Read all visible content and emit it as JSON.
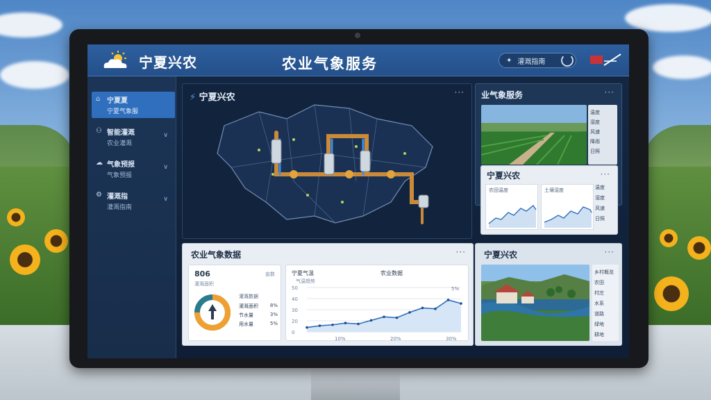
{
  "header": {
    "brand": "宁夏兴农",
    "title": "农业气象服务",
    "action_button": "灌溉指南"
  },
  "sidebar": {
    "items": [
      {
        "label": "宁夏夏",
        "sub": "宁夏气象服",
        "active": true
      },
      {
        "label": "智能灌溉",
        "sub": "农业灌溉",
        "active": false
      },
      {
        "label": "气象预报",
        "sub": "气象预报",
        "active": false
      },
      {
        "label": "灌溉指",
        "sub": "灌溉指南",
        "active": false
      }
    ]
  },
  "map_panel": {
    "title": "宁夏兴农",
    "more": "···"
  },
  "weather_panel": {
    "title": "业气象服务",
    "more": "···",
    "list": [
      "温度",
      "湿度",
      "风速",
      "降雨",
      "日照"
    ]
  },
  "sub_panel": {
    "title": "宁夏兴农",
    "more": "···",
    "mini1_header": "农田温度",
    "mini2_header": "土壤湿度",
    "list": [
      "温度",
      "湿度",
      "风速",
      "日照"
    ]
  },
  "bottom_panel": {
    "title": "农业气象数据",
    "more": "···",
    "stat_head": "806",
    "stat_sub": "灌溉面积",
    "stat_tag": "亩数",
    "legend_head": "灌溉数据",
    "legend": [
      {
        "label": "灌溉面积",
        "value": "8%"
      },
      {
        "label": "节水量",
        "value": "3%"
      },
      {
        "label": "用水量",
        "value": "5%"
      }
    ],
    "chart_h1": "宁夏气温",
    "chart_h2": "农业数据",
    "chart_sub": "气温趋势",
    "y_ticks": [
      "50",
      "40",
      "30",
      "20",
      "0"
    ],
    "x_ticks": [
      "10%",
      "20%",
      "30%"
    ],
    "peak_label": "5%"
  },
  "rural_panel": {
    "title": "宁夏兴农",
    "more": "···",
    "list": [
      "乡村概览",
      "农田",
      "村庄",
      "水系",
      "道路",
      "绿地",
      "耕地"
    ]
  },
  "colors": {
    "topbar": "#2e5f9e",
    "accent": "#2f6fbd",
    "chart_line": "#2f6fbd",
    "donut_orange": "#f0a030",
    "donut_teal": "#2a7b8e"
  },
  "chart_data": {
    "type": "line",
    "x": [
      0,
      1,
      2,
      3,
      4,
      5,
      6,
      7,
      8,
      9,
      10,
      11,
      12
    ],
    "series": [
      {
        "values": [
          5,
          7,
          8,
          10,
          9,
          13,
          17,
          16,
          22,
          27,
          26,
          36,
          32
        ]
      }
    ],
    "ylim": [
      0,
      50
    ]
  },
  "donut": {
    "value": 0.75
  }
}
